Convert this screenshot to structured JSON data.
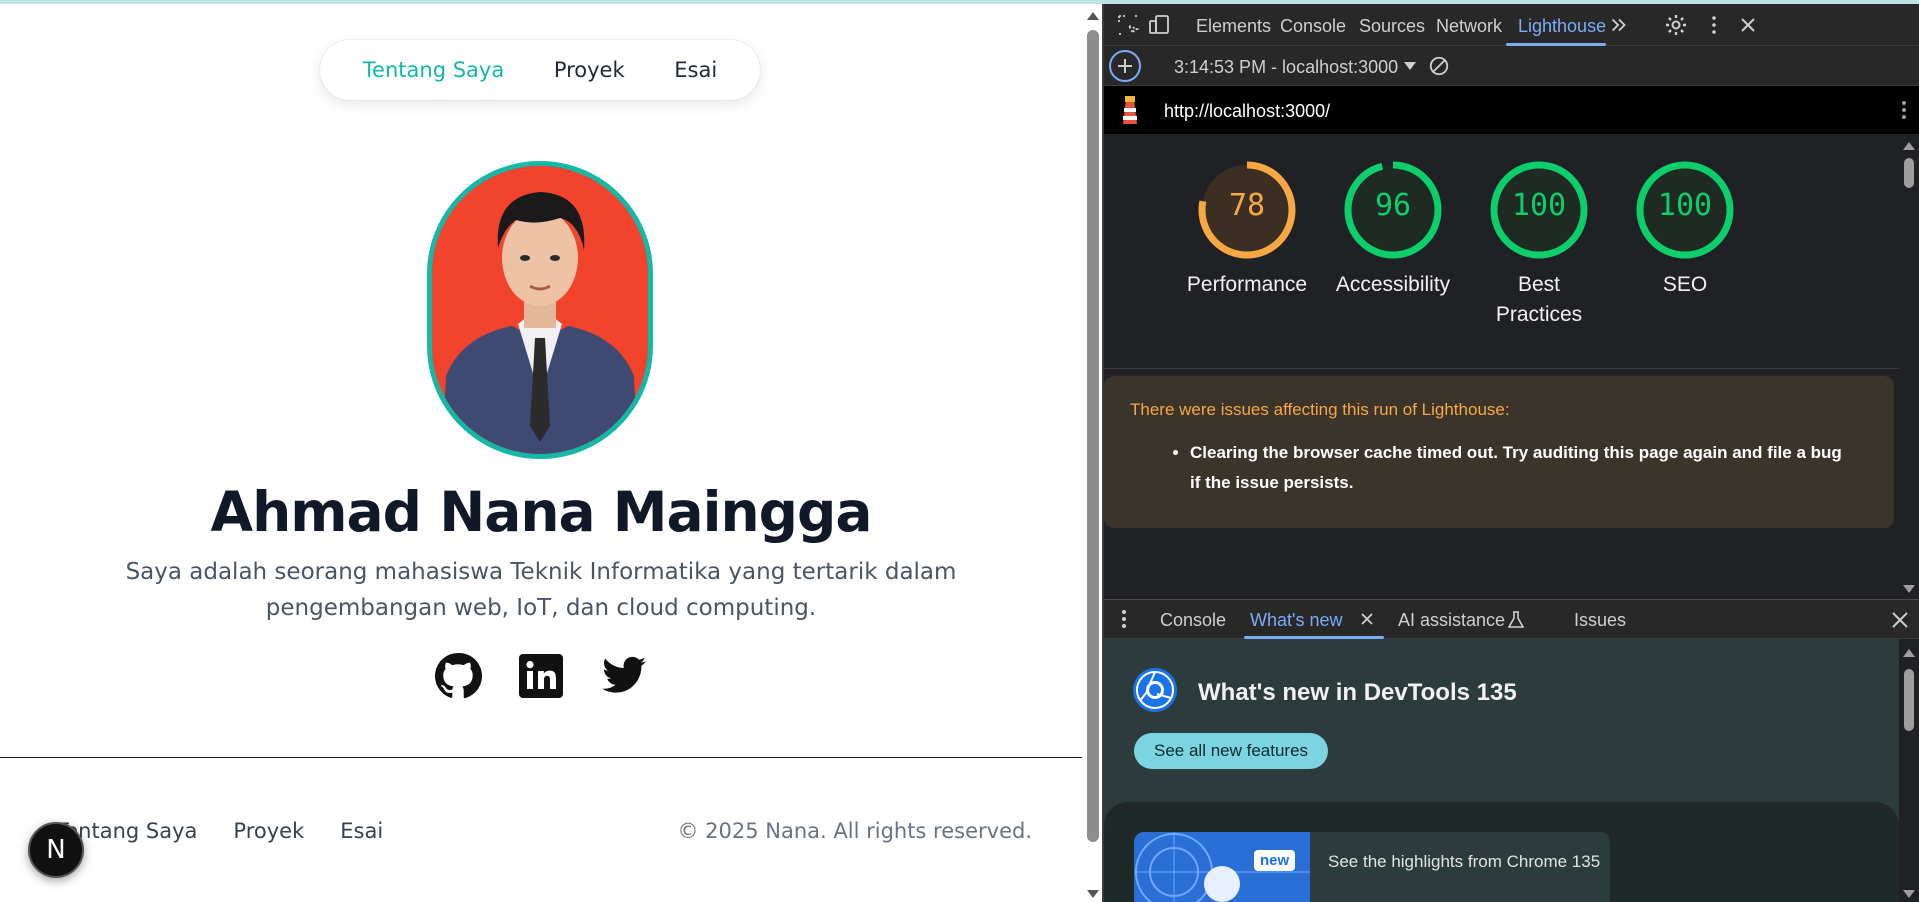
{
  "page": {
    "nav": {
      "items": [
        {
          "label": "Tentang Saya",
          "active": true
        },
        {
          "label": "Proyek",
          "active": false
        },
        {
          "label": "Esai",
          "active": false
        }
      ]
    },
    "profile": {
      "name": "Ahmad Nana Maingga",
      "bio": "Saya adalah seorang mahasiswa Teknik Informatika yang tertarik dalam pengembangan web, IoT, dan cloud computing.",
      "socials": [
        "github-icon",
        "linkedin-icon",
        "twitter-icon"
      ]
    },
    "footer": {
      "links": [
        "Tentang Saya",
        "Proyek",
        "Esai"
      ],
      "copyright": "© 2025 Nana. All rights reserved."
    },
    "badge": "N",
    "colors": {
      "accent": "#14b8a6",
      "heading": "#111827",
      "avatar_bg": "#f2432d"
    }
  },
  "devtools": {
    "tabs": [
      "Elements",
      "Console",
      "Sources",
      "Network",
      "Lighthouse"
    ],
    "active_tab": "Lighthouse",
    "report_selector": "3:14:53 PM - localhost:3000",
    "url": "http://localhost:3000/",
    "scores": [
      {
        "label": "Performance",
        "value": "78",
        "color": "#f7a843"
      },
      {
        "label": "Accessibility",
        "value": "96",
        "color": "#0cce6b"
      },
      {
        "label": "Best Practices",
        "value": "100",
        "color": "#0cce6b"
      },
      {
        "label": "SEO",
        "value": "100",
        "color": "#0cce6b"
      }
    ],
    "warning": {
      "heading": "There were issues affecting this run of Lighthouse:",
      "items": [
        "Clearing the browser cache timed out. Try auditing this page again and file a bug if the issue persists."
      ]
    },
    "drawer": {
      "tabs": [
        "Console",
        "What's new",
        "AI assistance",
        "Issues"
      ],
      "active_tab": "What's new",
      "title": "What's new in DevTools 135",
      "see_all": "See all new features",
      "badge_new": "new",
      "highlight": "See the highlights from Chrome 135"
    }
  }
}
